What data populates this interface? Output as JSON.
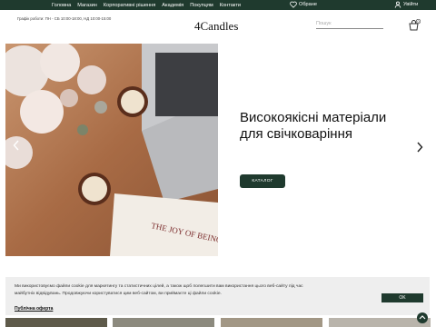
{
  "topbar": {
    "nav": [
      "Головна",
      "Магазин",
      "Корпоративні рішення",
      "Академія",
      "Покупцям",
      "Контакти"
    ],
    "favorites_label": "Обране",
    "login_label": "Увійти"
  },
  "header": {
    "hours": "Графік роботи: ПН - СБ 10:00-18:00, НД 10:00-15:00",
    "logo": "4Candles",
    "search_placeholder": "Пошук",
    "cart_count": "0"
  },
  "hero": {
    "headline": "Високоякісні матеріали для свічковаріння",
    "button_label": "КАТАЛОГ",
    "book_title": "THE JOY OF BEING"
  },
  "cookie": {
    "text": "Ми використовуємо файли cookie для маркетингу та статистичних цілей, а також щоб полегшити вам використання цього веб-сайту під час майбутніх відвідувань. Продовжуючи користуватися цим веб-сайтом, ви приймаєте ці файли cookie.",
    "link_label": "Публічна оферта",
    "ok_label": "OK"
  },
  "colors": {
    "brand": "#1f3a2e",
    "cookie_bg": "#eeeeee"
  },
  "icons": [
    "heart-icon",
    "user-icon",
    "cart-icon",
    "chevron-left-icon",
    "chevron-right-icon",
    "arrow-up-icon"
  ]
}
